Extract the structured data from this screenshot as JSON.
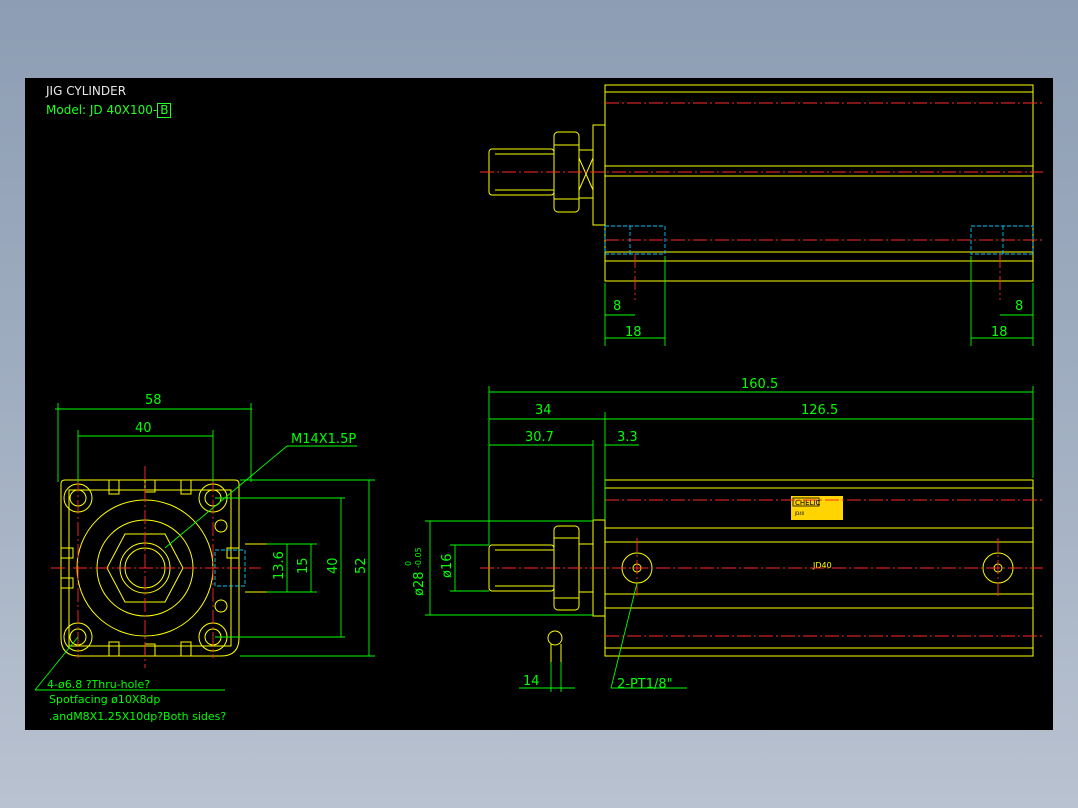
{
  "title": "JIG CYLINDER",
  "model_prefix": "Model: JD 40X100-",
  "model_suffix": "B",
  "top_view": {
    "dims": [
      "8",
      "18",
      "18",
      "8"
    ]
  },
  "front_view": {
    "dims": [
      "58",
      "40",
      "40",
      "52",
      "13.6",
      "15"
    ],
    "leader_thread": "M14X1.5P",
    "notes": [
      "4-ø6.8 ?Thru-hole?",
      "Spotfacing  ø10X8dp",
      ".andM8X1.25X10dp?Both sides?"
    ]
  },
  "side_view": {
    "dims": [
      "160.5",
      "34",
      "126.5",
      "30.7",
      "3.3",
      "ø16",
      "14"
    ],
    "rod_dia": "ø28",
    "tol_upper": "0",
    "tol_lower": "-0.05",
    "port_label": "2-PT1/8\"",
    "nameplate": "CHELIC",
    "nameplate_small": "JD40",
    "body_mark": "JD40"
  },
  "colors": {
    "background": "#000000",
    "outline": "#ffff00",
    "dimension": "#00ff00",
    "centerline": "#ff2a2a",
    "hidden": "#00c8ff"
  }
}
